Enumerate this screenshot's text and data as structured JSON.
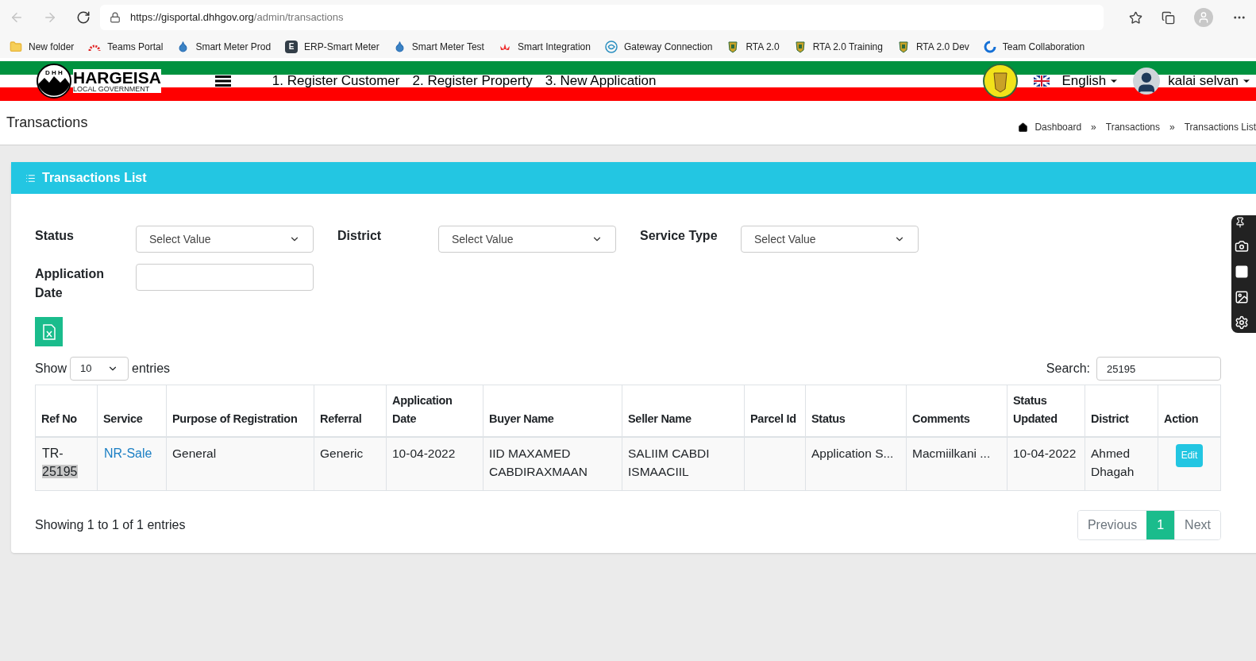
{
  "browser": {
    "url_host": "https://gisportal.dhhgov.org",
    "url_path": "/admin/transactions",
    "bookmarks": [
      {
        "label": "New folder",
        "kind": "folder"
      },
      {
        "label": "Teams Portal",
        "kind": "arc"
      },
      {
        "label": "Smart Meter Prod",
        "kind": "drop"
      },
      {
        "label": "ERP-Smart Meter",
        "kind": "letter",
        "icon_letter": "E"
      },
      {
        "label": "Smart Meter Test",
        "kind": "drop"
      },
      {
        "label": "Smart Integration",
        "kind": "lotus"
      },
      {
        "label": "Gateway Connection",
        "kind": "swirl"
      },
      {
        "label": "RTA 2.0",
        "kind": "crest"
      },
      {
        "label": "RTA 2.0 Training",
        "kind": "crest"
      },
      {
        "label": "RTA 2.0 Dev",
        "kind": "crest"
      },
      {
        "label": "Team Collaboration",
        "kind": "ring"
      }
    ]
  },
  "header": {
    "logo_letters": "D H H",
    "logo_name": "HARGEISA",
    "logo_sub": "LOCAL GOVERNMENT",
    "nav": [
      "1. Register Customer",
      "2. Register Property",
      "3. New Application"
    ],
    "language": "English",
    "user": "kalai selvan"
  },
  "page": {
    "title": "Transactions",
    "breadcrumbs": [
      "Dashboard",
      "Transactions",
      "Transactions List"
    ],
    "separator": "»"
  },
  "card": {
    "title": "Transactions List",
    "filters": [
      {
        "label": "Status",
        "kind": "select",
        "value": "Select Value"
      },
      {
        "label": "District",
        "kind": "select",
        "value": "Select Value"
      },
      {
        "label": "Service Type",
        "kind": "select",
        "value": "Select Value"
      },
      {
        "label": "Application Date",
        "kind": "input"
      }
    ],
    "show_label": "Show",
    "page_size": "10",
    "entries_label": "entries",
    "search_label": "Search:",
    "search_value": "25195",
    "columns": [
      "Ref No",
      "Service",
      "Purpose of Registration",
      "Referral",
      "Application Date",
      "Buyer Name",
      "Seller Name",
      "Parcel Id",
      "Status",
      "Comments",
      "Status Updated",
      "District",
      "Action"
    ],
    "rows": [
      {
        "ref_prefix": "TR-",
        "ref_match": "25195",
        "service": "NR-Sale",
        "purpose": "General",
        "referral": "Generic",
        "application_date": "10-04-2022",
        "buyer": "IID MAXAMED CABDIRAXMAAN",
        "seller": "SALIIM CABDI ISMAACIIL",
        "parcel_id": "",
        "status": "Application S...",
        "comments": "Macmiilkani ...",
        "status_updated": "10-04-2022",
        "district": "Ahmed Dhagah",
        "action": "Edit"
      }
    ],
    "summary": "Showing 1 to 1 of 1 entries",
    "pagination": [
      {
        "label": "Previous",
        "selected": false
      },
      {
        "label": "1",
        "selected": true
      },
      {
        "label": "Next",
        "selected": false
      }
    ]
  }
}
